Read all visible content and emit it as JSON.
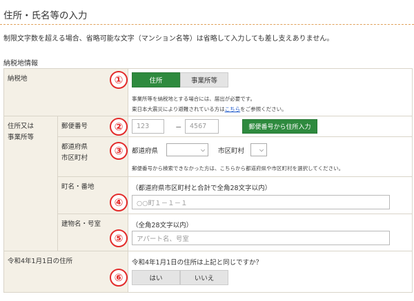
{
  "page": {
    "title": "住所・氏名等の入力",
    "notice": "制限文字数を超える場合、省略可能な文字（マンション名等）は省略して入力しても差し支えありません。",
    "section_label": "納税地情報"
  },
  "markers": [
    "①",
    "②",
    "③",
    "④",
    "⑤",
    "⑥"
  ],
  "tax_place": {
    "label": "納税地",
    "options": [
      "住所",
      "事業所等"
    ],
    "selected": "住所",
    "note1": "事業所等を納税地とする場合には、届出が必要です。",
    "note2_prefix": "東日本大震災により避難されている方は",
    "note2_link": "こちら",
    "note2_suffix": "をご参照ください。"
  },
  "address": {
    "group_label_line1": "住所又は",
    "group_label_line2": "事業所等",
    "postal": {
      "label": "郵便番号",
      "placeholder1": "123",
      "dash": "－",
      "placeholder2": "4567",
      "lookup_button": "郵便番号から住所入力"
    },
    "pref_city": {
      "label_line1": "都道府県",
      "label_line2": "市区町村",
      "pref_label": "都道府県",
      "city_label": "市区町村",
      "note": "郵便番号から検索できなかった方は、こちらから都道府県や市区町村を選択してください。"
    },
    "street": {
      "label": "町名・番地",
      "hint": "（都道府県市区町村と合計で全角28文字以内）",
      "placeholder": "○○町１－１－１"
    },
    "building": {
      "label": "建物名・号室",
      "hint": "（全角28文字以内）",
      "placeholder": "アパート名、号室"
    }
  },
  "prior_address": {
    "label": "令和4年1月1日の住所",
    "question": "令和4年1月1日の住所は上記と同じですか？",
    "options": [
      "はい",
      "いいえ"
    ]
  },
  "colors": {
    "accent_green": "#2e8a3e",
    "marker_red": "#e32b2b",
    "header_bg": "#f4f0e6",
    "link_blue": "#1a55c8"
  }
}
